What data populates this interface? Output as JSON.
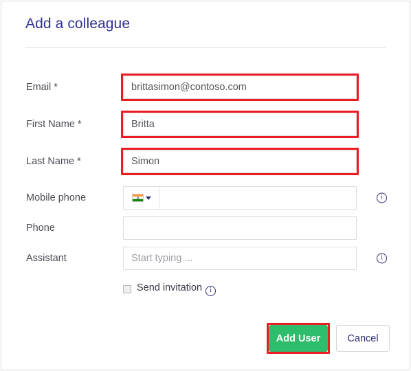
{
  "dialog": {
    "title": "Add a colleague"
  },
  "form": {
    "rows": [
      {
        "label": "Email *",
        "value": "brittasimon@contoso.com",
        "placeholder": ""
      },
      {
        "label": "First Name *",
        "value": "Britta",
        "placeholder": ""
      },
      {
        "label": "Last Name *",
        "value": "Simon",
        "placeholder": ""
      },
      {
        "label": "Mobile phone",
        "value": "",
        "placeholder": ""
      },
      {
        "label": "Phone",
        "value": "",
        "placeholder": ""
      },
      {
        "label": "Assistant",
        "value": "",
        "placeholder": "Start typing ..."
      }
    ],
    "country_flag": "india-flag-icon",
    "dropdown_icon": "chevron-down-icon",
    "info_icon": "info-icon",
    "send_invitation": {
      "label": "Send invitation",
      "checked": false
    }
  },
  "footer": {
    "add_user_label": "Add User",
    "cancel_label": "Cancel"
  },
  "colors": {
    "accent_green": "#2ebd6b",
    "annotation_red": "#ed1c24",
    "title_navy": "#2e3192",
    "label_gray": "#4b4b55",
    "border_gray": "#dcdcdf"
  },
  "annotations": {
    "highlighted_fields": [
      "Email *",
      "First Name *",
      "Last Name *"
    ],
    "highlighted_button": "Add User"
  }
}
